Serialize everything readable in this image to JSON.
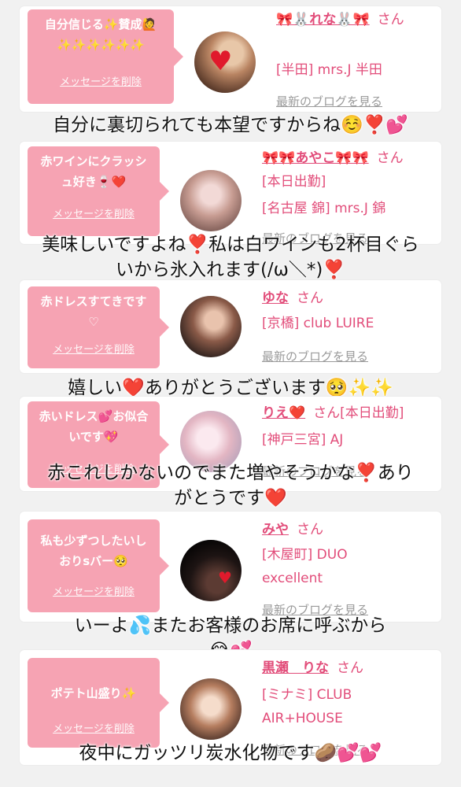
{
  "delete_label": "メッセージを削除",
  "blog_label": "最新のブログを見る",
  "san": "さん",
  "colors": {
    "accent": "#e24d7a",
    "bubble": "#f6a3b3"
  },
  "messages": [
    {
      "bubble": "自分信じる✨賛成🙋✨✨✨✨✨✨",
      "name": "🎀🐰れな🐰🎀",
      "shop_line1": "[半田] mrs.J 半田",
      "reply": "自分に裏切られても本望ですからね☺️❣️💕"
    },
    {
      "bubble": "赤ワインにクラッシュ好き🍷❤️",
      "name": "🎀🎀あやこ🎀🎀",
      "shop_line1": "[本日出勤]",
      "shop_line2": "[名古屋 錦] mrs.J 錦",
      "reply_line1": "美味しいですよね❣️私は白ワインも2杯目ぐら",
      "reply_line2": "いから氷入れます(/ω＼*)❣️"
    },
    {
      "bubble": "赤ドレスすてきです♡",
      "name": "ゆな",
      "shop_line1": "[京橋] club LUIRE",
      "reply": "嬉しい❤️ありがとうございます🥺✨✨"
    },
    {
      "bubble": "赤いドレス💕お似合いです💖",
      "name": "りえ❤️",
      "name_suffix": "[本日出勤]",
      "shop_line1": "[神戸三宮] AJ",
      "reply_line1": "赤これしかないのでまた増やそうかな❣️あり",
      "reply_line2": "がとうです❤️"
    },
    {
      "bubble": "私も少ずつしたいしおりsバー🥺",
      "name": "みや",
      "shop_line1": "[木屋町] DUO",
      "shop_line2": "excellent",
      "reply_line1": "いーよ💦またお客様のお席に呼ぶから",
      "reply_line2": "😂💕"
    },
    {
      "bubble": "ポテト山盛り✨",
      "name": "黒瀬　りな",
      "shop_line1": "[ミナミ] CLUB",
      "shop_line2": "AIR+HOUSE",
      "reply": "夜中にガッツリ炭水化物です🥔💕💕"
    }
  ]
}
